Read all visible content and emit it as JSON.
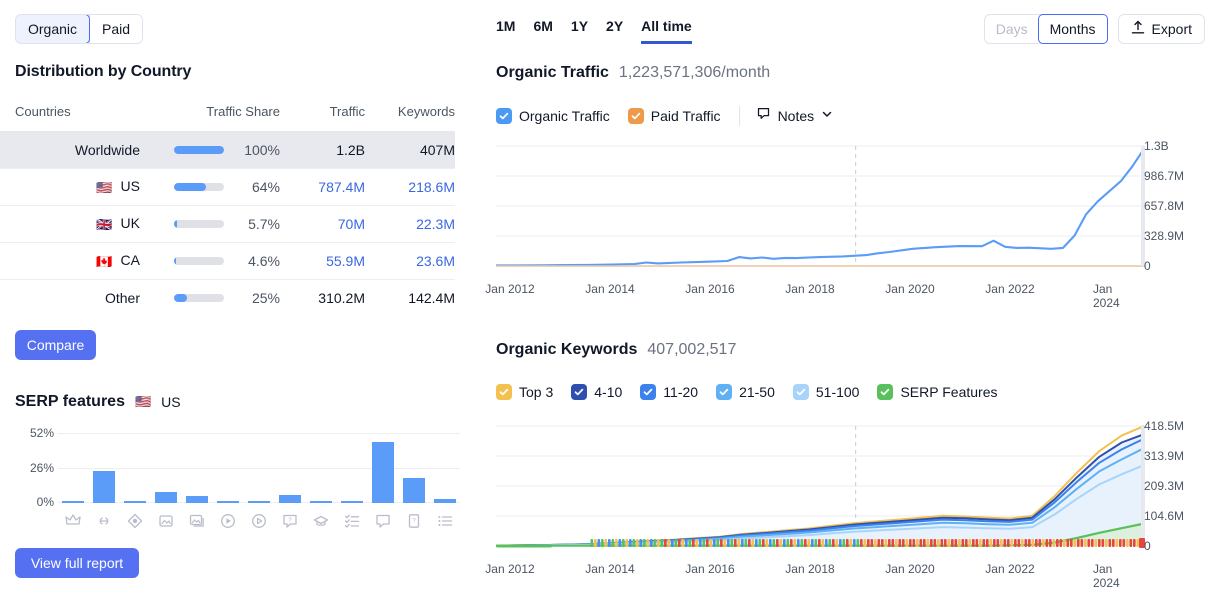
{
  "left_panel": {
    "mode_toggle": {
      "options": [
        "Organic",
        "Paid"
      ],
      "selected": "Organic"
    },
    "distribution": {
      "title": "Distribution by Country",
      "columns": [
        "Countries",
        "Traffic Share",
        "Traffic",
        "Keywords"
      ],
      "rows": [
        {
          "flag": "",
          "country": "Worldwide",
          "share_pct": 100,
          "share_label": "100%",
          "traffic": "1.2B",
          "keywords": "407M",
          "highlighted": true,
          "linked": false
        },
        {
          "flag": "🇺🇸",
          "country": "US",
          "share_pct": 64,
          "share_label": "64%",
          "traffic": "787.4M",
          "keywords": "218.6M",
          "highlighted": false,
          "linked": true
        },
        {
          "flag": "🇬🇧",
          "country": "UK",
          "share_pct": 5.7,
          "share_label": "5.7%",
          "traffic": "70M",
          "keywords": "22.3M",
          "highlighted": false,
          "linked": true
        },
        {
          "flag": "🇨🇦",
          "country": "CA",
          "share_pct": 4.6,
          "share_label": "4.6%",
          "traffic": "55.9M",
          "keywords": "23.6M",
          "highlighted": false,
          "linked": true
        },
        {
          "flag": "",
          "country": "Other",
          "share_pct": 25,
          "share_label": "25%",
          "traffic": "310.2M",
          "keywords": "142.4M",
          "highlighted": false,
          "linked": false
        }
      ]
    },
    "compare_button": "Compare",
    "view_full_report_button": "View full report",
    "serp_features": {
      "title": "SERP features",
      "country_flag": "🇺🇸",
      "country_code": "US"
    }
  },
  "right_panel": {
    "range_tabs": {
      "options": [
        "1M",
        "6M",
        "1Y",
        "2Y",
        "All time"
      ],
      "selected": "All time"
    },
    "granularity": {
      "options": [
        "Days",
        "Months"
      ],
      "selected": "Months",
      "disabled": [
        "Days"
      ]
    },
    "export_button": "Export",
    "organic_traffic": {
      "title": "Organic Traffic",
      "value": "1,223,571,306/month",
      "legend": [
        {
          "label": "Organic Traffic",
          "color": "#4a9af5",
          "checked": true
        },
        {
          "label": "Paid Traffic",
          "color": "#ef9a4b",
          "checked": true
        }
      ],
      "notes_label": "Notes"
    },
    "organic_keywords": {
      "title": "Organic Keywords",
      "value": "407,002,517",
      "legend": [
        {
          "label": "Top 3",
          "color": "#f2c14e",
          "checked": true
        },
        {
          "label": "4-10",
          "color": "#2f4fb0",
          "checked": true
        },
        {
          "label": "11-20",
          "color": "#3b82ef",
          "checked": true
        },
        {
          "label": "21-50",
          "color": "#5fb0f5",
          "checked": true
        },
        {
          "label": "51-100",
          "color": "#a9d4fa",
          "checked": true
        },
        {
          "label": "SERP Features",
          "color": "#59c05b",
          "checked": true
        }
      ]
    }
  },
  "chart_data": [
    {
      "type": "bar",
      "name": "serp-features-distribution",
      "title": "SERP features",
      "xlabel": "",
      "ylabel": "",
      "ylim": [
        0,
        52
      ],
      "yticks": [
        0,
        26,
        52
      ],
      "ytick_labels": [
        "0%",
        "26%",
        "52%"
      ],
      "categories": [
        "featured-snippet",
        "sitelinks",
        "knowledge-panel",
        "image-pack",
        "thumbnail",
        "video",
        "video-preview",
        "people-also-ask",
        "top-stories",
        "faq",
        "discussions",
        "shopping",
        "list"
      ],
      "values": [
        1.0,
        24.0,
        1.2,
        8.0,
        5.0,
        1.2,
        1.2,
        5.8,
        1.0,
        1.0,
        46.0,
        19.0,
        3.0
      ],
      "color": "#5a9cf8",
      "grid": true
    },
    {
      "type": "line",
      "name": "organic-traffic-over-time",
      "title": "Organic Traffic",
      "subtitle": "1,223,571,306/month",
      "xlabel": "",
      "ylabel": "",
      "ylim": [
        0,
        1300000000
      ],
      "yticks": [
        0,
        328900000,
        657800000,
        986700000,
        1300000000
      ],
      "ytick_labels": [
        "0",
        "328.9M",
        "657.8M",
        "986.7M",
        "1.3B"
      ],
      "xtick_labels": [
        "Jan 2012",
        "Jan 2014",
        "Jan 2016",
        "Jan 2018",
        "Jan 2020",
        "Jan 2022",
        "Jan 2024"
      ],
      "x_start": "Jan 2011",
      "x_end": "Jan 2025",
      "grid": true,
      "series": [
        {
          "name": "Organic Traffic",
          "color": "#5a9cf8",
          "x": [
            "2011-01",
            "2011-07",
            "2012-01",
            "2012-07",
            "2013-01",
            "2013-07",
            "2014-01",
            "2014-04",
            "2014-07",
            "2015-01",
            "2015-07",
            "2016-01",
            "2016-04",
            "2016-07",
            "2016-10",
            "2017-01",
            "2017-04",
            "2017-07",
            "2017-10",
            "2018-01",
            "2018-07",
            "2019-01",
            "2019-04",
            "2019-07",
            "2020-01",
            "2020-07",
            "2021-01",
            "2021-07",
            "2021-10",
            "2022-01",
            "2022-04",
            "2022-07",
            "2023-01",
            "2023-04",
            "2023-07",
            "2023-10",
            "2024-01",
            "2024-07",
            "2024-10",
            "2025-01"
          ],
          "values": [
            6000000,
            7000000,
            8000000,
            10000000,
            12000000,
            16000000,
            22000000,
            38000000,
            28000000,
            38000000,
            46000000,
            54000000,
            96000000,
            82000000,
            92000000,
            78000000,
            88000000,
            86000000,
            92000000,
            96000000,
            104000000,
            118000000,
            138000000,
            152000000,
            186000000,
            204000000,
            216000000,
            214000000,
            274000000,
            208000000,
            196000000,
            198000000,
            186000000,
            196000000,
            330000000,
            560000000,
            700000000,
            920000000,
            1080000000,
            1270000000
          ]
        },
        {
          "name": "Paid Traffic",
          "color": "#ecc3a0",
          "x": [
            "2011-01",
            "2025-01"
          ],
          "values": [
            0,
            0
          ]
        }
      ]
    },
    {
      "type": "area",
      "name": "organic-keywords-over-time",
      "title": "Organic Keywords",
      "subtitle": "407,002,517",
      "xlabel": "",
      "ylabel": "",
      "ylim": [
        0,
        418500000
      ],
      "yticks": [
        0,
        104600000,
        209300000,
        313900000,
        418500000
      ],
      "ytick_labels": [
        "0",
        "104.6M",
        "209.3M",
        "313.9M",
        "418.5M"
      ],
      "xtick_labels": [
        "Jan 2012",
        "Jan 2014",
        "Jan 2016",
        "Jan 2018",
        "Jan 2020",
        "Jan 2022",
        "Jan 2024"
      ],
      "x_start": "Jan 2011",
      "x_end": "Jan 2025",
      "stacked": true,
      "grid": true,
      "series": [
        {
          "name": "51-100",
          "color": "#a9d4fa",
          "values": [
            1000000,
            1500000,
            2000000,
            3000000,
            4000000,
            6000000,
            9000000,
            11000000,
            14000000,
            17000000,
            20000000,
            26000000,
            30000000,
            34000000,
            38000000,
            44000000,
            50000000,
            54000000,
            58000000,
            62000000,
            66000000,
            64000000,
            62000000,
            60000000,
            66000000,
            110000000,
            165000000,
            215000000,
            250000000,
            282000000
          ]
        },
        {
          "name": "21-50",
          "color": "#5fb0f5",
          "values": [
            1200000,
            1800000,
            2400000,
            3600000,
            5000000,
            7000000,
            11000000,
            14000000,
            17000000,
            21000000,
            25000000,
            32000000,
            37000000,
            42000000,
            47000000,
            54000000,
            61000000,
            66000000,
            71000000,
            76000000,
            81000000,
            79000000,
            76000000,
            74000000,
            81000000,
            135000000,
            200000000,
            260000000,
            302000000,
            341000000
          ]
        },
        {
          "name": "11-20",
          "color": "#3b82ef",
          "values": [
            1400000,
            2100000,
            2800000,
            4200000,
            5800000,
            8000000,
            12500000,
            16000000,
            19500000,
            24000000,
            28500000,
            36500000,
            42000000,
            48000000,
            53500000,
            61500000,
            69500000,
            75000000,
            80500000,
            86000000,
            92000000,
            90000000,
            86500000,
            84000000,
            92000000,
            152000000,
            224000000,
            290000000,
            337000000,
            374000000
          ]
        },
        {
          "name": "4-10",
          "color": "#2f4fb0",
          "values": [
            1500000,
            2250000,
            3000000,
            4500000,
            6200000,
            8600000,
            13400000,
            17200000,
            21000000,
            25800000,
            30600000,
            39200000,
            45100000,
            51500000,
            57400000,
            66000000,
            74600000,
            80500000,
            86400000,
            92300000,
            98700000,
            96600000,
            92800000,
            90100000,
            98700000,
            163000000,
            240000000,
            311000000,
            361000000,
            390000000
          ]
        },
        {
          "name": "Top 3",
          "color": "#f2c14e",
          "values": [
            1600000,
            2400000,
            3200000,
            4800000,
            6600000,
            9200000,
            14300000,
            18400000,
            22400000,
            27500000,
            32600000,
            41800000,
            48100000,
            54900000,
            61200000,
            70400000,
            79500000,
            85800000,
            92100000,
            98400000,
            105200000,
            103000000,
            98900000,
            96000000,
            105200000,
            174000000,
            256000000,
            331000000,
            385000000,
            418500000
          ]
        },
        {
          "name": "SERP Features",
          "color": "#59c05b",
          "values": [
            1000000,
            1000000,
            1000000,
            1000000,
            1000000,
            1000000,
            1000000,
            1000000,
            1000000,
            1000000,
            1000000,
            1000000,
            1000000,
            1000000,
            1000000,
            1000000,
            1000000,
            1000000,
            1000000,
            1000000,
            1000000,
            1000000,
            1000000,
            2000000,
            4000000,
            12000000,
            28000000,
            46000000,
            62000000,
            78000000
          ]
        }
      ]
    }
  ]
}
